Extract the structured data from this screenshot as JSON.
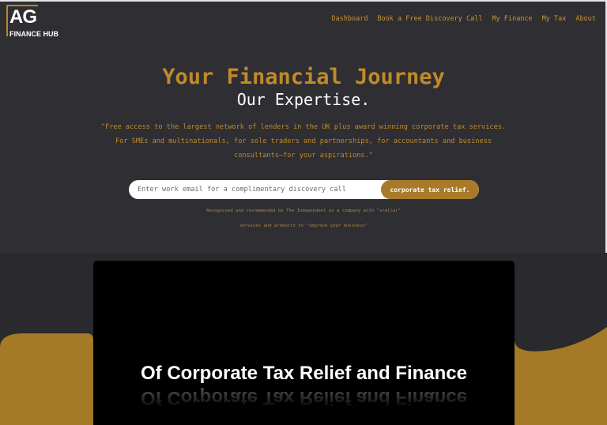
{
  "brand": {
    "logo_letters": "AG",
    "logo_subtitle": "FINANCE HUB"
  },
  "nav": {
    "items": [
      {
        "label": "Dashboard"
      },
      {
        "label": "Book a Free Discovery Call"
      },
      {
        "label": "My Finance"
      },
      {
        "label": "My Tax"
      },
      {
        "label": "About"
      }
    ]
  },
  "hero": {
    "title": "Your Financial Journey",
    "subtitle": "Our Expertise.",
    "quote": "\"Free access to the largest network of lenders in the UK plus award winning corporate tax services. For SMEs and multinationals, for sole traders and partnerships, for accountants and business consultants—for your aspirations.\""
  },
  "signup": {
    "email_placeholder": "Enter work email for a complimentary discovery call",
    "email_value": "",
    "button_label": "corporate tax relief."
  },
  "recognition": {
    "line1": "Recognised and recommended by The Independent as a company with \"stellar\"",
    "line2": "services and products to \"improve your business\""
  },
  "video": {
    "headline": "Of Corporate Tax Relief and Finance"
  },
  "colors": {
    "background": "#2f2e33",
    "accent_gold": "#c08a2a",
    "button_gold": "#a87a2a",
    "panel": "#000000",
    "text_light": "#ffffff"
  }
}
